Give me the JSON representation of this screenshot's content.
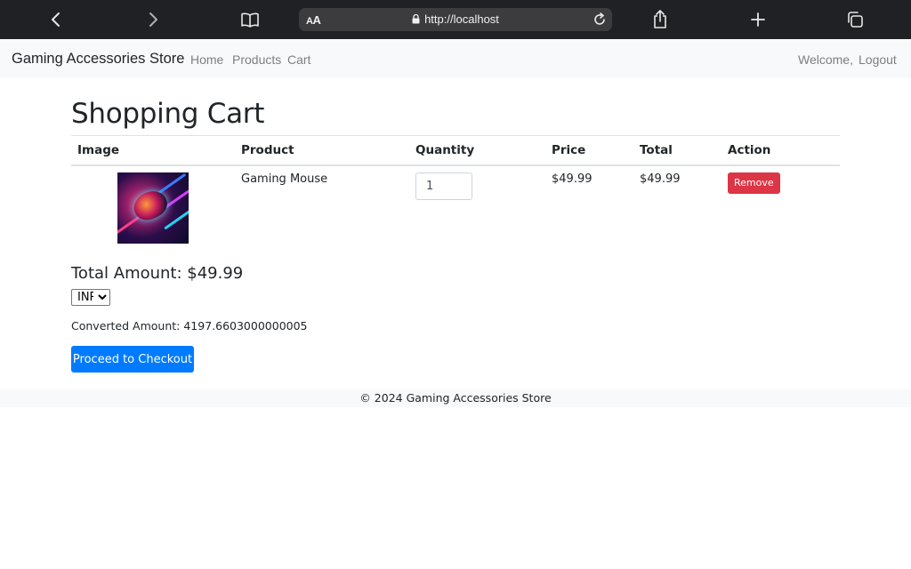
{
  "browser": {
    "url": "http://localhost",
    "aa_small": "A",
    "aa_big": "A"
  },
  "navbar": {
    "brand": "Gaming Accessories Store",
    "links": [
      "Home",
      "Products",
      "Cart"
    ],
    "welcome": "Welcome,",
    "logout": "Logout"
  },
  "page": {
    "title": "Shopping Cart"
  },
  "cart": {
    "headers": [
      "Image",
      "Product",
      "Quantity",
      "Price",
      "Total",
      "Action"
    ],
    "items": [
      {
        "product": "Gaming Mouse",
        "quantity": "1",
        "price": "$49.99",
        "total": "$49.99",
        "action": "Remove"
      }
    ]
  },
  "summary": {
    "total_label": "Total Amount: $49.99",
    "currency_selected": "INR",
    "converted_label": "Converted Amount: 4197.6603000000005",
    "checkout_label": "Proceed to Checkout"
  },
  "footer": {
    "text": "© 2024 Gaming Accessories Store"
  },
  "colors": {
    "primary": "#007bff",
    "danger": "#dc3545",
    "navbar_bg": "#f8f9fa",
    "chrome_bg": "#202124"
  }
}
